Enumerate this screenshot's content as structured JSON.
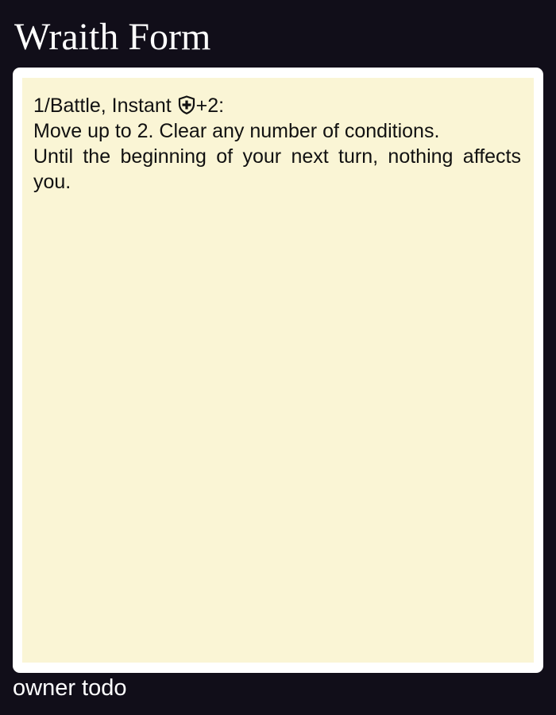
{
  "card": {
    "title": "Wraith Form",
    "ability": {
      "trigger_prefix": "1/Battle, Instant ",
      "cost_icon": "shield-plus-icon",
      "trigger_suffix": "+2:",
      "effect_line_1": "Move up to 2. Clear any number of conditions.",
      "effect_line_2": "Until the beginning of your next turn, nothing affects you."
    },
    "owner": "owner todo"
  },
  "colors": {
    "background": "#110e19",
    "frame": "#ffffff",
    "body": "#faf5d5",
    "text": "#111111"
  }
}
